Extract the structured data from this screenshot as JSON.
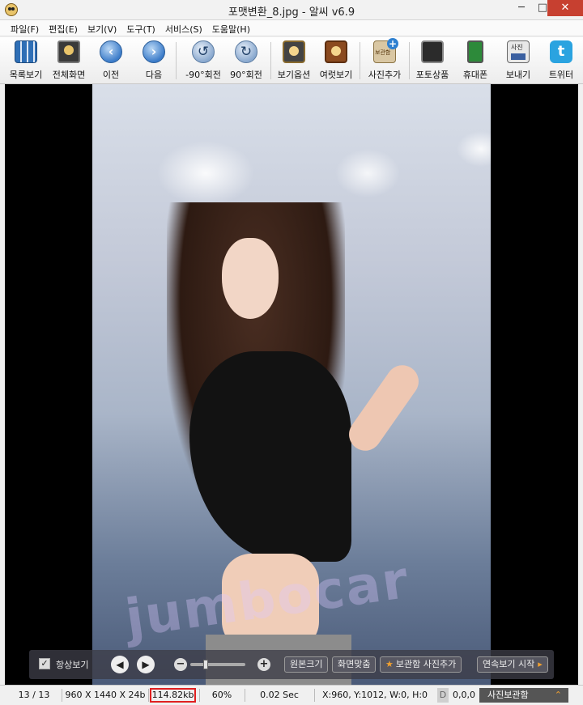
{
  "window": {
    "title": "포맷변환_8.jpg - 알씨 v6.9",
    "minimize": "─",
    "maximize": "□",
    "close": "✕"
  },
  "menu": [
    {
      "label": "파일(F)"
    },
    {
      "label": "편집(E)"
    },
    {
      "label": "보기(V)"
    },
    {
      "label": "도구(T)"
    },
    {
      "label": "서비스(S)"
    },
    {
      "label": "도움말(H)"
    }
  ],
  "toolbar": {
    "list_view": "목록보기",
    "fullscreen": "전체화면",
    "prev": "이전",
    "next": "다음",
    "rotate_left": "-90°회전",
    "rotate_right": "90°회전",
    "view_options": "보기옵션",
    "multi_view": "여럿보기",
    "add_photo": "사진추가",
    "add_photo_badge": "보관함",
    "photo_product": "포토상품",
    "mobile": "휴대폰",
    "send": "보내기",
    "send_badge": "사진",
    "twitter": "트위터",
    "prev_glyph": "‹",
    "next_glyph": "›",
    "rot_left_glyph": "↺",
    "rot_right_glyph": "↻",
    "twitter_glyph": "t"
  },
  "viewer": {
    "watermark": "jumbocar",
    "controls": {
      "checkbox_mark": "✓",
      "always_view": "항상보기",
      "prev_glyph": "◀",
      "next_glyph": "▶",
      "zoom_out": "−",
      "zoom_in": "+",
      "zoom_level": 0.25,
      "original_size": "원본크기",
      "fit_screen": "화면맞춤",
      "add_to_album_star": "★",
      "add_to_album": "보관함 사진추가",
      "slideshow": "연속보기 시작",
      "slideshow_arrow": "▸"
    }
  },
  "status": {
    "index": "13 / 13",
    "dimensions": "960 X 1440 X 24b",
    "filesize": "114.82kb",
    "zoom": "60%",
    "load_time": "0.02 Sec",
    "cursor": "X:960, Y:1012, W:0, H:0",
    "dkey": "D",
    "color": "0,0,0",
    "album": "사진보관함",
    "album_chevron": "⌃"
  },
  "colors": {
    "highlight_border": "#e02020",
    "close_button": "#c74030",
    "accent_orange": "#f0a030"
  }
}
